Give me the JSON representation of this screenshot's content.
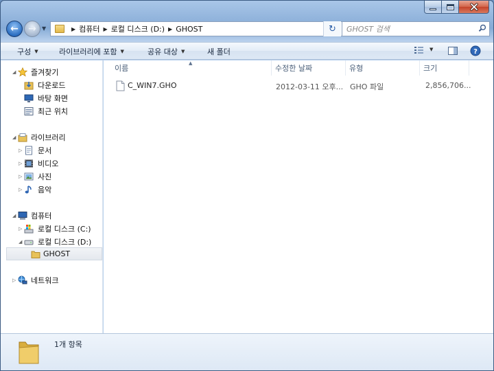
{
  "window": {
    "address": {
      "crumbs": [
        "컴퓨터",
        "로컬 디스크 (D:)",
        "GHOST"
      ]
    },
    "search": {
      "placeholder": "GHOST 검색"
    }
  },
  "toolbar": {
    "organize_label": "구성",
    "library_label": "라이브러리에 포함",
    "share_label": "공유 대상",
    "new_folder_label": "새 폴더"
  },
  "nav": {
    "favorites": {
      "label": "즐겨찾기",
      "items": [
        "다운로드",
        "바탕 화면",
        "최근 위치"
      ]
    },
    "libraries": {
      "label": "라이브러리",
      "items": [
        "문서",
        "비디오",
        "사진",
        "음악"
      ]
    },
    "computer": {
      "label": "컴퓨터",
      "items": [
        "로컬 디스크 (C:)",
        "로컬 디스크 (D:)",
        "GHOST"
      ]
    },
    "network": {
      "label": "네트워크"
    }
  },
  "columns": {
    "name": "이름",
    "modified": "수정한 날짜",
    "type": "유형",
    "size": "크기"
  },
  "files": [
    {
      "name": "C_WIN7.GHO",
      "modified": "2012-03-11 오후...",
      "type": "GHO 파일",
      "size": "2,856,706..."
    }
  ],
  "status": {
    "item_count": "1개 항목"
  },
  "colors": {
    "title_gradient": "#86abd6",
    "toolbar_bg": "#dde8f5",
    "folder_yellow": "#e8c25a",
    "selection_bg": "#e4e8ee"
  }
}
